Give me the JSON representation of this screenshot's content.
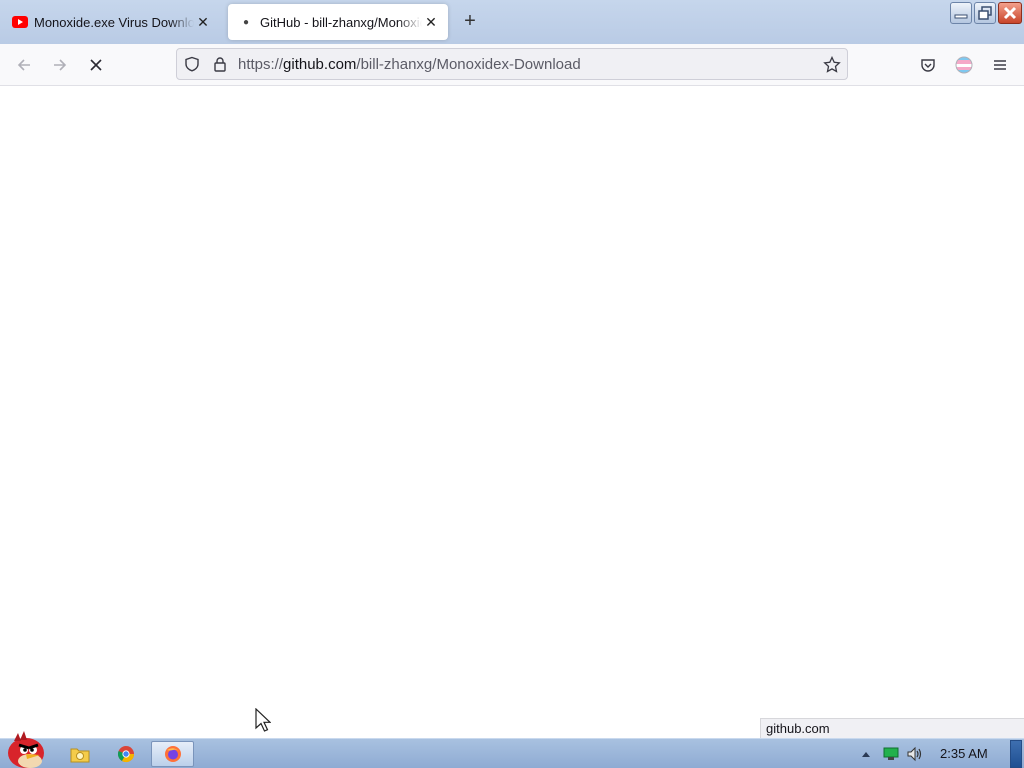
{
  "browser": {
    "tabs": [
      {
        "title": "Monoxide.exe Virus Download",
        "active": false,
        "icon": "youtube-icon"
      },
      {
        "title": "GitHub - bill-zhanxg/Monoxidex-Download",
        "active": true,
        "icon": "loading-dot"
      }
    ],
    "new_tab_glyph": "+",
    "url": {
      "scheme": "https://",
      "host": "github.com",
      "path": "/bill-zhanxg/Monoxidex-Download"
    },
    "status_text": "github.com"
  },
  "taskbar": {
    "apps": [
      "angry-birds-start-icon",
      "file-explorer-icon",
      "chrome-icon",
      "firefox-icon"
    ],
    "active_app": "firefox-icon",
    "tray_icons": [
      "show-hidden-icons-arrow",
      "network-icon",
      "volume-icon"
    ],
    "clock": "2:35 AM"
  },
  "colors": {
    "tabstrip": "#c6d6ec",
    "taskbar": "#9bb5d9",
    "youtube_red": "#ff0000",
    "close_red": "#c8452a"
  }
}
